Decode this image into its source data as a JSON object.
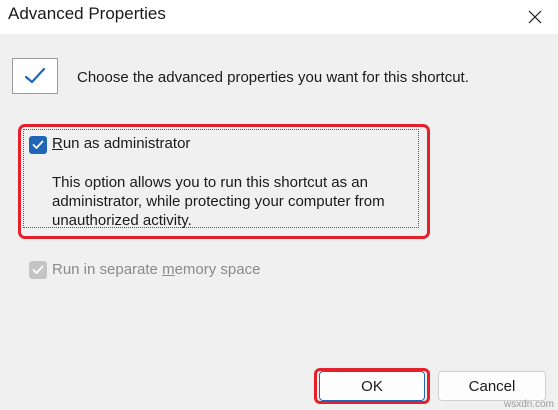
{
  "window": {
    "title": "Advanced Properties",
    "close_label": "✕"
  },
  "intro": {
    "icon": "checkmark-icon",
    "text": "Choose the advanced properties you want for this shortcut."
  },
  "options": {
    "run_as_admin": {
      "label_prefix": "R",
      "label_rest": "un as administrator",
      "checked": true,
      "description": "This option allows you to run this shortcut as an administrator, while protecting your computer from unauthorized activity."
    },
    "separate_memory": {
      "label_before": "Run in separate ",
      "label_mnemonic": "m",
      "label_after": "emory space",
      "checked": true,
      "enabled": false
    }
  },
  "buttons": {
    "ok_label": "OK",
    "cancel_label": "Cancel"
  },
  "colors": {
    "highlight": "#e4202b",
    "accent": "#1f66b7"
  },
  "watermark": "wsxdn.com"
}
